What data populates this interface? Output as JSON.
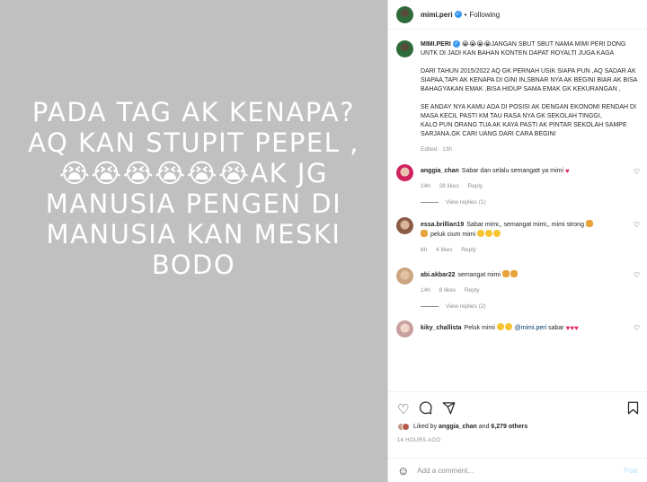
{
  "media": {
    "text_lines": [
      "PADA TAG AK KENAPA?",
      "AQ KAN STUPIT PEPEL ,",
      "😭😭😭😭😭😭AK JG",
      "MANUSIA PENGEN DI",
      "MANUSIA KAN MESKI",
      "BODO"
    ],
    "background": "#c0c0c0"
  },
  "header": {
    "username": "mimi.peri",
    "separator": "•",
    "follow_status": "Following"
  },
  "caption": {
    "username": "mimi.peri",
    "p1": "JANGAN SBUT SBUT NAMA MIMI PERI DONG UNTK DI JADI KAN BAHAN KONTEN DAPAT ROYALTI JUGA KAGA",
    "p2": "DARI TAHUN 2015/2022 AQ GK PERNAH USIK SIAPA PUN ,AQ SADAR AK SIAPAA,TAPI AK KENAPA DI GINI IN,SBNAR NYA AK BEGINI BIAR AK BISA BAHAGYAKAN EMAK ,BISA HIDUP SAMA EMAK GK KEKURANGAN ,",
    "p3": "SE ANDAY NYA KAMU ADA DI POSISI AK DENGAN EKONOMI RENDAH DI MASA KECIL PASTI KM TAU RASA NYA GK SEKOLAH TINGGI,",
    "p4": "KALO PUN ORANG TUA AK KAYA PASTI AK PINTAR SEKOLAH SAMPE SARJANA,GK CARI UANG DARI CARA BEGINI",
    "meta": "Edited · 13h"
  },
  "comments": [
    {
      "user": "anggia_chan",
      "text": "Sabar dan selalu semangatt ya mimi",
      "time": "14h",
      "likes": "28 likes",
      "reply": "Reply",
      "view_replies": "View replies (1)"
    },
    {
      "user": "essa.brillian19",
      "text": "Sabar mimi,, semangat mimi,, mimi strong",
      "text2": "peluk cium mimi",
      "time": "8h",
      "likes": "4 likes",
      "reply": "Reply"
    },
    {
      "user": "abi.akbar22",
      "text": "semangat mimi",
      "time": "14h",
      "likes": "8 likes",
      "reply": "Reply",
      "view_replies": "View replies (2)"
    },
    {
      "user": "kiky_challista",
      "text": "Peluk mimi",
      "mention": "@mimi.peri",
      "text2": "sabar"
    }
  ],
  "likes": {
    "prefix": "Liked by",
    "user": "anggia_chan",
    "middle": "and",
    "others": "6,279 others"
  },
  "time_ago": "14 HOURS AGO",
  "add_comment": {
    "placeholder": "Add a comment...",
    "post_label": "Post"
  },
  "icons": {
    "like": "heart-icon",
    "comment": "comment-icon",
    "share": "share-icon",
    "save": "bookmark-icon",
    "emoji": "smile-icon"
  },
  "colors": {
    "verified": "#3897f0",
    "heart": "#e0245e",
    "post_disabled": "#b2dffc"
  }
}
